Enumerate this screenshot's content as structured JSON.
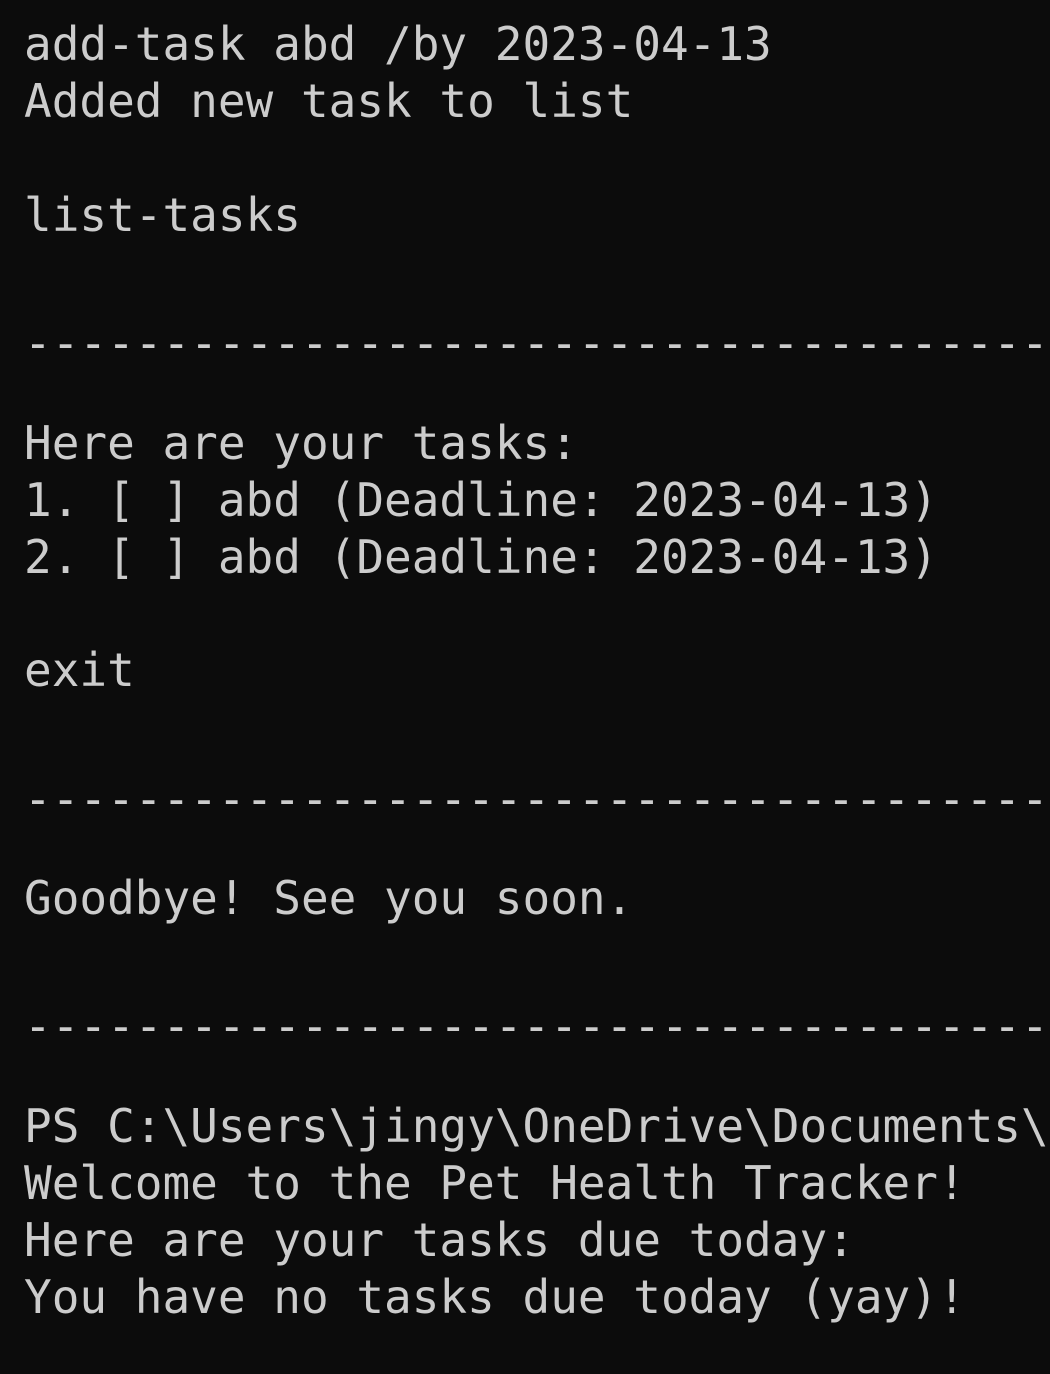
{
  "terminal": {
    "lines": [
      "add-task abd /by 2023-04-13",
      "Added new task to list",
      "list-tasks",
      "----------------------------------------",
      "Here are your tasks:",
      "1. [ ] abd (Deadline: 2023-04-13)",
      "2. [ ] abd (Deadline: 2023-04-13)",
      "exit",
      "----------------------------------------",
      "Goodbye! See you soon.",
      "----------------------------------------",
      "PS C:\\Users\\jingy\\OneDrive\\Documents\\",
      "Welcome to the Pet Health Tracker!",
      "Here are your tasks due today:",
      "You have no tasks due today (yay)!"
    ]
  }
}
